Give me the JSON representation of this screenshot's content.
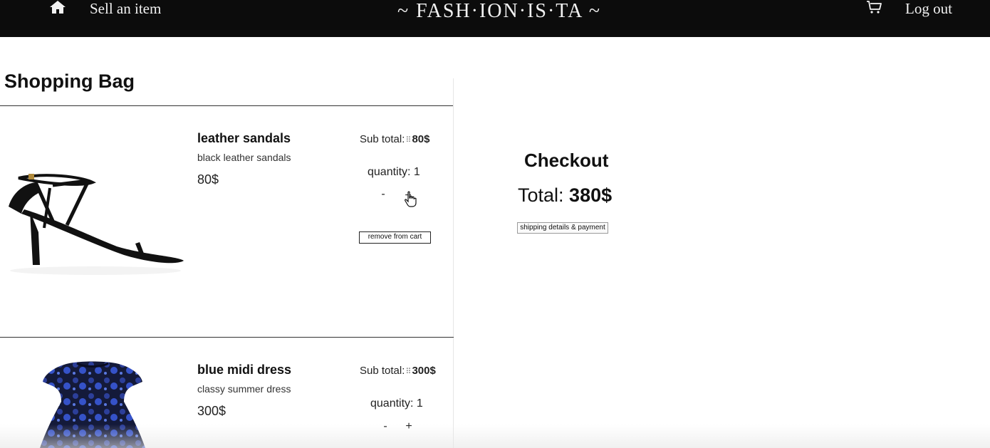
{
  "header": {
    "sell_label": "Sell an item",
    "brand": "~ FASH·ION·IS·TA ~",
    "logout_label": "Log out",
    "icons": {
      "home": "home-icon",
      "cart": "cart-icon"
    },
    "background": "#0c0c0c"
  },
  "bag": {
    "title": "Shopping Bag",
    "items": [
      {
        "name": "leather sandals",
        "description": "black leather sandals",
        "price": "80$",
        "subtotal_label": "Sub total:",
        "subtotal_value": "80$",
        "quantity_label": "quantity: 1",
        "minus": "-",
        "plus": "+",
        "remove_label": "remove from cart"
      },
      {
        "name": "blue midi dress",
        "description": "classy summer dress",
        "price": "300$",
        "subtotal_label": "Sub total:",
        "subtotal_value": "300$",
        "quantity_label": "quantity: 1",
        "minus": "-",
        "plus": "+"
      }
    ]
  },
  "checkout": {
    "title": "Checkout",
    "total_label": "Total: ",
    "total_value": "380$",
    "button_label": "shipping details & payment"
  }
}
